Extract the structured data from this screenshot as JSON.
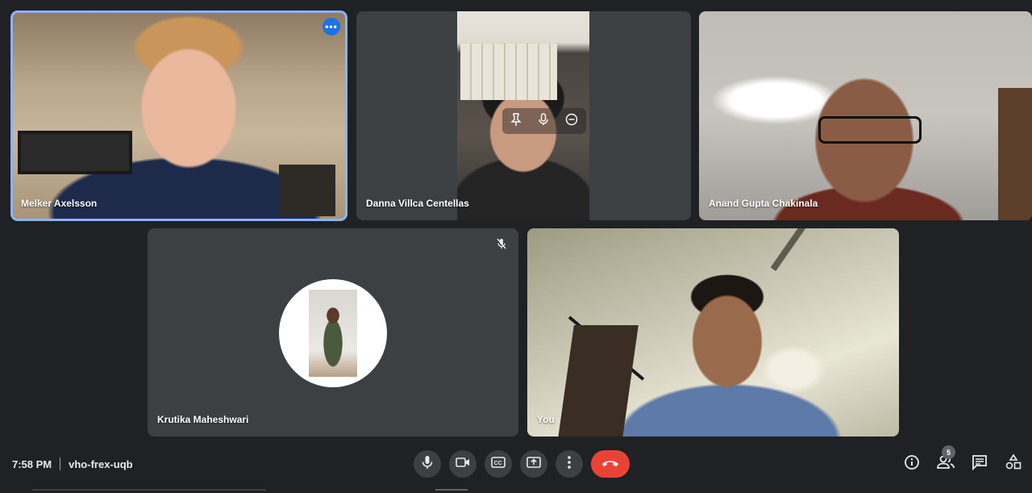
{
  "participants": [
    {
      "name": "Melker Axelsson"
    },
    {
      "name": "Danna Villca Centellas"
    },
    {
      "name": "Anand Gupta Chakinala"
    },
    {
      "name": "Krutika Maheshwari"
    },
    {
      "name": "You"
    }
  ],
  "meeting": {
    "time": "7:58 PM",
    "code": "vho-frex-uqb"
  },
  "people_count": "5",
  "icons": {
    "more": "more-horiz-icon",
    "mic": "microphone-icon",
    "camera": "videocam-icon",
    "captions": "closed-captions-icon",
    "present": "present-screen-icon",
    "options": "more-vert-icon",
    "end_call": "end-call-icon",
    "info": "info-icon",
    "people": "people-icon",
    "chat": "chat-icon",
    "activities": "activities-icon"
  },
  "colors": {
    "background": "#202124",
    "tile": "#3c4043",
    "active_border": "#8ab4f8",
    "end_call": "#ea4335",
    "accent": "#1a73e8"
  }
}
